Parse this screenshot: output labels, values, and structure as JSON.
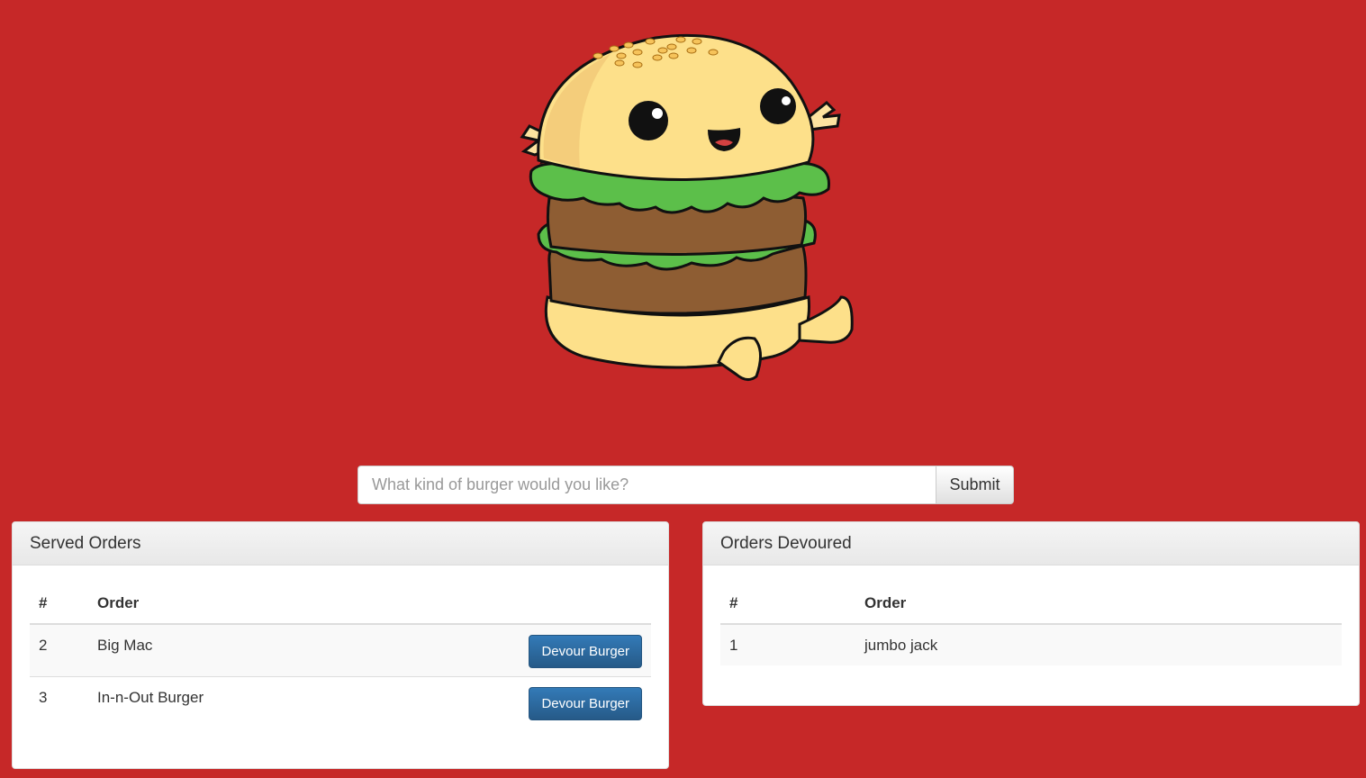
{
  "form": {
    "placeholder": "What kind of burger would you like?",
    "submit_label": "Submit"
  },
  "served": {
    "heading": "Served Orders",
    "columns": [
      "#",
      "Order"
    ],
    "rows": [
      {
        "id": "2",
        "order": "Big Mac",
        "action_label": "Devour Burger"
      },
      {
        "id": "3",
        "order": "In-n-Out Burger",
        "action_label": "Devour Burger"
      }
    ]
  },
  "devoured": {
    "heading": "Orders Devoured",
    "columns": [
      "#",
      "Order"
    ],
    "rows": [
      {
        "id": "1",
        "order": "jumbo jack"
      }
    ]
  },
  "colors": {
    "background": "#c62828",
    "primary_button": "#337ab7"
  },
  "icons": {
    "mascot": "burger-mascot-icon"
  }
}
